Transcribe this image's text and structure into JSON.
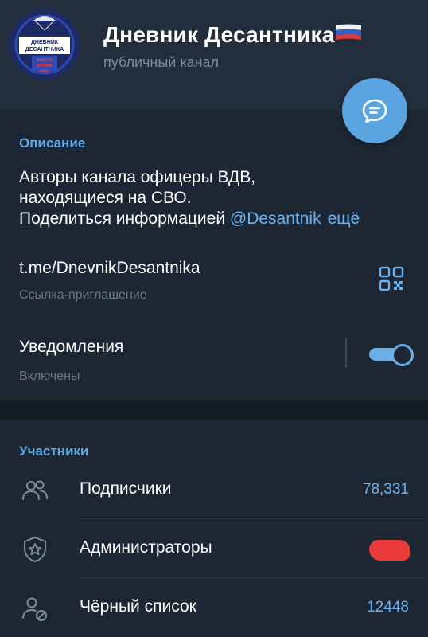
{
  "header": {
    "title": "Дневник Десантника",
    "subtitle": "публичный канал",
    "avatar_logo_text": [
      "ДНЕВНИК",
      "ДЕСАНТНИКА",
      "НИКТО",
      "КРОМЕ",
      "НАС"
    ],
    "flag_icon": "russia-flag-icon",
    "fab_icon": "chat-bubble-icon",
    "colors": {
      "fab": "#5aa5e0",
      "accent": "#5ea8e3"
    }
  },
  "info": {
    "description_title": "Описание",
    "description_lines": [
      "Авторы канала офицеры ВДВ,",
      "находящиеся на СВО."
    ],
    "description_last_prefix": "Поделиться информацией ",
    "description_mention": "@Desantnik",
    "more_label": "ещё",
    "link": "t.me/DnevnikDesantnika",
    "link_caption": "Ссылка-приглашение",
    "qr_icon": "qr-code-icon",
    "notifications_label": "Уведомления",
    "notifications_status": "Включены",
    "notifications_on": true
  },
  "members": {
    "title": "Участники",
    "rows": [
      {
        "icon": "subscribers-icon",
        "label": "Подписчики",
        "value": "78,331"
      },
      {
        "icon": "admin-shield-icon",
        "label": "Администраторы",
        "value": ""
      },
      {
        "icon": "blocked-user-icon",
        "label": "Чёрный список",
        "value": "12448"
      }
    ]
  }
}
